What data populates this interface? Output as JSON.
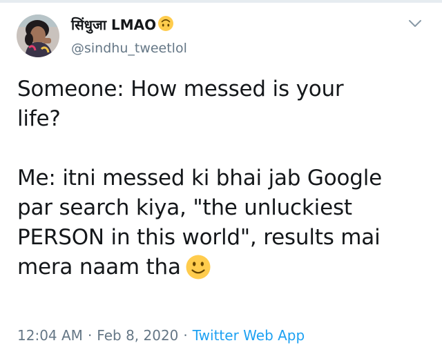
{
  "tweet": {
    "author": {
      "display_name": "सिंधुजा LMAO",
      "name_emoji": "upside-down-face-emoji",
      "handle": "@sindhu_tweetlol",
      "avatar": "user-avatar-photo"
    },
    "menu_icon": "chevron-down-icon",
    "text_lines": [
      "Someone: How messed is your",
      "life?",
      "",
      "Me: itni messed ki bhai jab Google",
      "par search kiya, \"the unluckiest",
      "PERSON in this world\", results mai",
      "mera naam tha"
    ],
    "text_emoji": "slightly-smiling-face-emoji",
    "time": "12:04 AM",
    "separator": "·",
    "date": "Feb 8, 2020",
    "source": "Twitter Web App"
  },
  "colors": {
    "text": "#14171a",
    "secondary": "#657786",
    "link": "#1da1f2",
    "border": "#e6ecf0"
  }
}
